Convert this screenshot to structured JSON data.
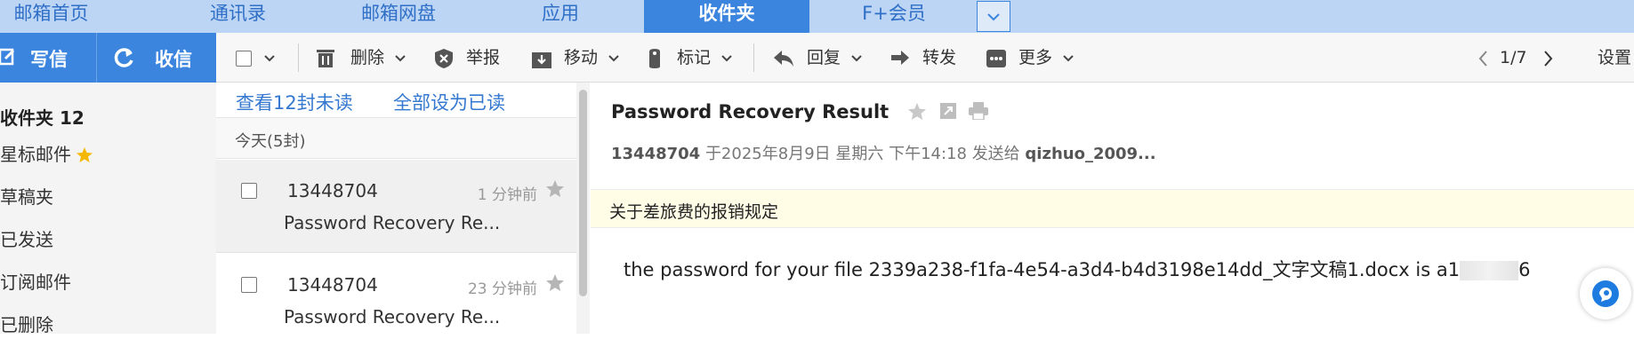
{
  "nav": {
    "tabs": [
      {
        "label": "邮箱首页"
      },
      {
        "label": "通讯录"
      },
      {
        "label": "邮箱网盘"
      },
      {
        "label": "应用"
      },
      {
        "label": "收件夹",
        "active": true
      },
      {
        "label": "F+会员"
      }
    ]
  },
  "actions": {
    "write": "写信",
    "receive": "收信"
  },
  "toolbar": {
    "delete": "删除",
    "report": "举报",
    "move": "移动",
    "mark": "标记",
    "reply": "回复",
    "forward": "转发",
    "more": "更多",
    "page": "1/7",
    "settings": "设置"
  },
  "sidebar": {
    "inbox": "收件夹 12",
    "starred": "星标邮件",
    "drafts": "草稿夹",
    "sent": "已发送",
    "subscriptions": "订阅邮件",
    "deleted": "已删除"
  },
  "list": {
    "view_unread": "查看12封未读",
    "mark_all_read": "全部设为已读",
    "group_today": "今天(5封)",
    "items": [
      {
        "from": "13448704",
        "time": "1 分钟前",
        "subject": "Password Recovery Re..."
      },
      {
        "from": "13448704",
        "time": "23 分钟前",
        "subject": "Password Recovery Re..."
      }
    ]
  },
  "reader": {
    "title": "Password Recovery Result",
    "sender": "13448704",
    "date_text": "于2025年8月9日 星期六 下午14:18 发送给",
    "recipient": "qizhuo_2009...",
    "subject_line": "关于差旅费的报销规定",
    "body_prefix": "the password for your file 2339a238-f1fa-4e54-a3d4-b4d3198e14dd_文字文稿1.docx is a1",
    "body_suffix": "6"
  },
  "colors": {
    "brand": "#3b85df",
    "nav_bg": "#bcd5f5",
    "star": "#f5b800"
  }
}
